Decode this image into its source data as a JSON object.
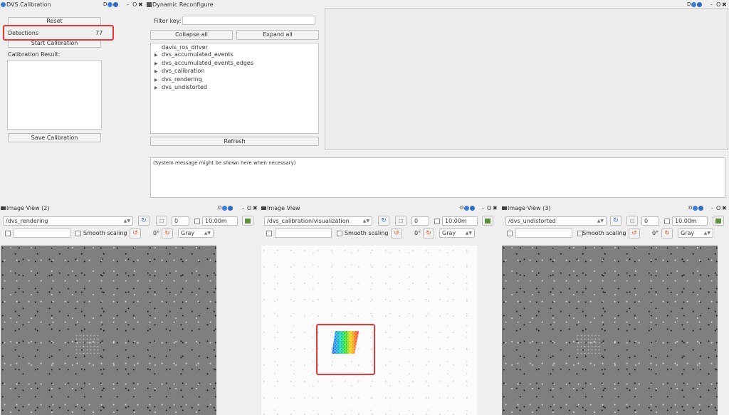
{
  "dvs_panel": {
    "title": "DVS Calibration",
    "reset_label": "Reset",
    "detections_label": "Detections",
    "detections_value": "77",
    "start_label": "Start Calibration",
    "result_label": "Calibration Result:",
    "save_label": "Save Calibration"
  },
  "reconf_panel": {
    "title": "Dynamic Reconfigure",
    "filter_label": "Filter key:",
    "filter_value": "",
    "collapse_label": "Collapse all",
    "expand_label": "Expand all",
    "tree": [
      "davis_ros_driver",
      "dvs_accumulated_events",
      "dvs_accumulated_events_edges",
      "dvs_calibration",
      "dvs_rendering",
      "dvs_undistorted"
    ],
    "refresh_label": "Refresh",
    "system_message": "(System message might be shown here when necessary)"
  },
  "window_buttons": {
    "dash": "-",
    "circle": "O",
    "close": "✖",
    "d": "D"
  },
  "image_views": [
    {
      "title": "Image View (2)",
      "topic": "/dvs_rendering",
      "spin": "0",
      "rate": "10.00m",
      "smooth": "Smooth scaling",
      "rotation": "0°",
      "colormap": "Gray"
    },
    {
      "title": "Image View",
      "topic": "/dvs_calibration/visualization",
      "spin": "0",
      "rate": "10.00m",
      "smooth": "Smooth scaling",
      "rotation": "0°",
      "colormap": "Gray"
    },
    {
      "title": "Image View (3)",
      "topic": "/dvs_undistorted",
      "spin": "0",
      "rate": "10.00m",
      "smooth": "Smooth scaling",
      "rotation": "0°",
      "colormap": "Gray"
    }
  ],
  "colors": {
    "highlight": "#e53935",
    "panel_bg": "#efefef",
    "image_gray": "#7f7f7f"
  }
}
